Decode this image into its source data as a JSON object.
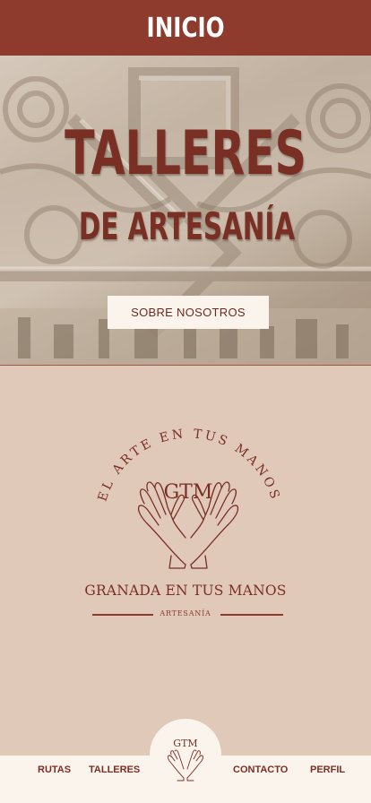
{
  "header": {
    "title": "INICIO"
  },
  "hero": {
    "title_line1": "TALLERES",
    "title_line2": "DE ARTESANÍA",
    "about_button": "SOBRE NOSOTROS"
  },
  "logo": {
    "arc_text": "EL ARTE EN TUS MANOS",
    "monogram": "GTM",
    "brand": "GRANADA EN TUS MANOS",
    "subtitle": "ARTESANÍA"
  },
  "nav": {
    "items": [
      "RUTAS",
      "TALLERES",
      "CONTACTO",
      "PERFIL"
    ],
    "center_monogram": "GTM"
  },
  "colors": {
    "primary": "#8e3a2d",
    "background": "#e0c9b9",
    "nav_background": "#fbf4ed",
    "text_dark": "#7a2f25"
  }
}
